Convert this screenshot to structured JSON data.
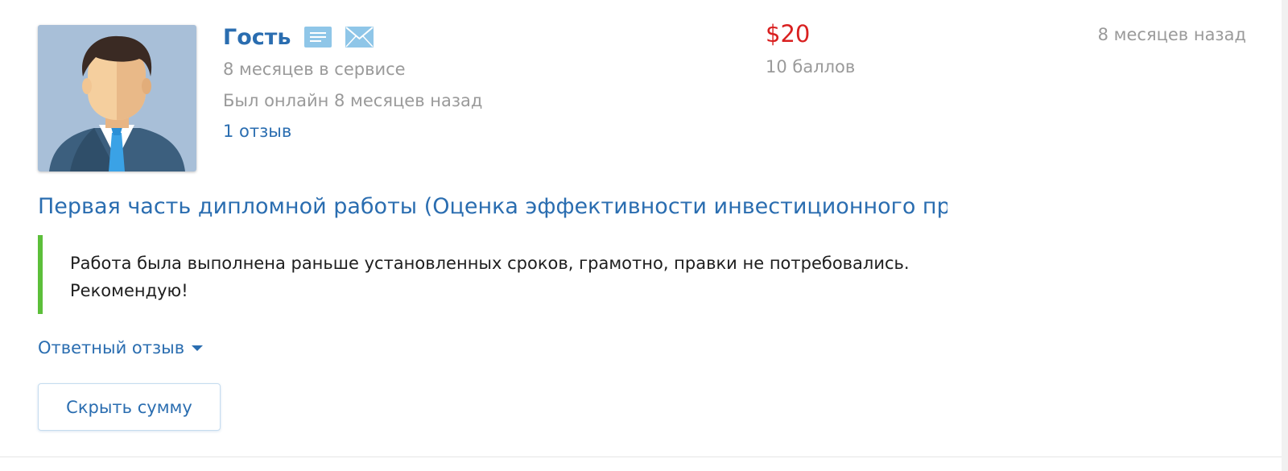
{
  "review": {
    "user": {
      "name": "Гость",
      "avatar_icon": "user-avatar-man-in-suit",
      "service_time": "8 месяцев в сервисе",
      "last_online": "Был онлайн 8 месяцев назад",
      "review_count": "1 отзыв",
      "profile_icon": "profile-card-icon",
      "message_icon": "envelope-icon"
    },
    "price": "$20",
    "points": "10 баллов",
    "posted_time": "8 месяцев назад",
    "work_title": "Первая часть дипломной работы (Оценка эффективности инвестиционного пр",
    "text_line1": "Работа была выполнена раньше установленных сроков, грамотно, правки не потребовались.",
    "text_line2": "Рекомендую!",
    "reply_toggle_label": "Ответный отзыв",
    "hide_sum_label": "Скрыть сумму"
  },
  "colors": {
    "link": "#2a6db0",
    "price": "#d92020",
    "muted": "#9a9a9a",
    "quote_border": "#5cbf3a",
    "icon_light_blue": "#8fc6e8"
  }
}
